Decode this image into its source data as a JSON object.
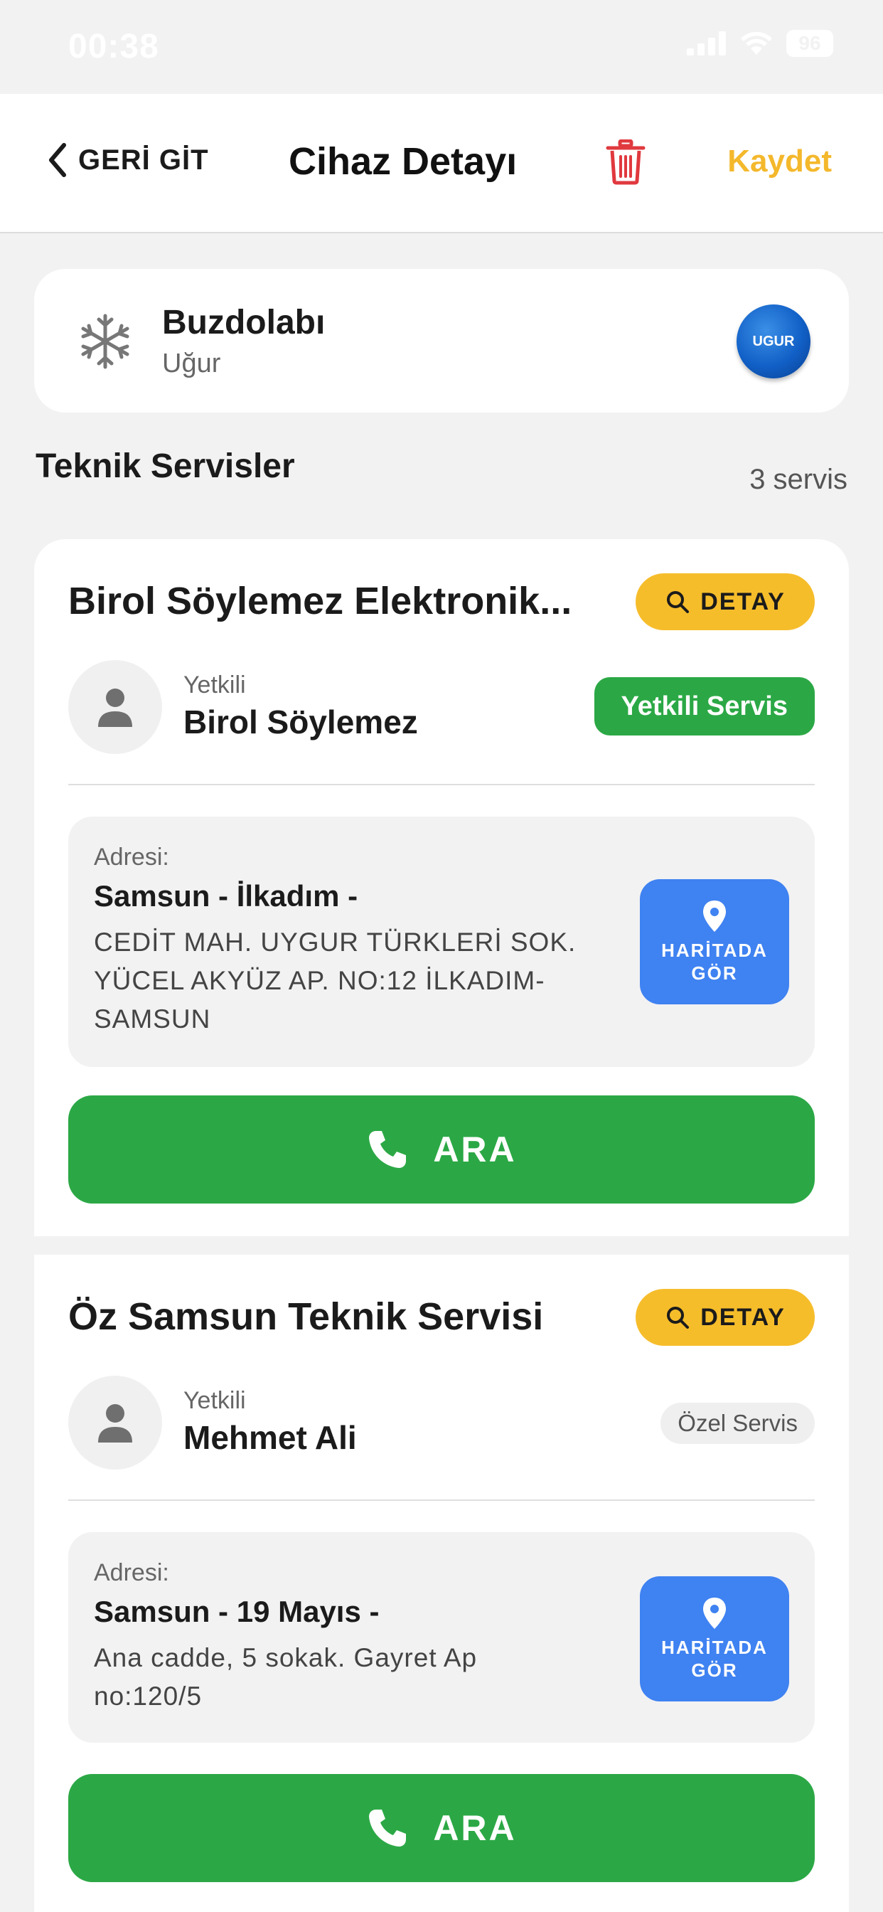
{
  "status_bar": {
    "time": "00:38",
    "battery": "96"
  },
  "nav": {
    "back_label": "GERİ GİT",
    "title": "Cihaz Detayı",
    "save_label": "Kaydet"
  },
  "device": {
    "name": "Buzdolabı",
    "brand": "Uğur",
    "brand_logo_text": "UGUR",
    "icon": "snowflake-icon"
  },
  "services_section": {
    "title": "Teknik Servisler",
    "count": "3 servis"
  },
  "services": [
    {
      "name": "Birol Söylemez Elektronik...",
      "detail_label": "DETAY",
      "role_label": "Yetkili",
      "person": "Birol Söylemez",
      "badge": "Yetkili Servis",
      "address_label": "Adresi:",
      "city": "Samsun - İlkadım -",
      "address": "CEDİT MAH. UYGUR TÜRKLERİ SOK. YÜCEL AKYÜZ AP. NO:12 İLKADIM-SAMSUN",
      "map_label_1": "HARİTADA",
      "map_label_2": "GÖR",
      "call_label": "ARA"
    },
    {
      "name": "Öz Samsun Teknik Servisi",
      "detail_label": "DETAY",
      "role_label": "Yetkili",
      "person": "Mehmet Ali",
      "badge": "Özel Servis",
      "address_label": "Adresi:",
      "city": "Samsun - 19 Mayıs -",
      "address": "Ana cadde, 5 sokak. Gayret Ap no:120/5",
      "map_label_1": "HARİTADA",
      "map_label_2": "GÖR",
      "call_label": "ARA"
    }
  ],
  "colors": {
    "accent_yellow": "#f6bd2b",
    "save_yellow": "#f4b82c",
    "green": "#2ba845",
    "blue": "#3f82f1",
    "trash_red": "#e0393e"
  }
}
